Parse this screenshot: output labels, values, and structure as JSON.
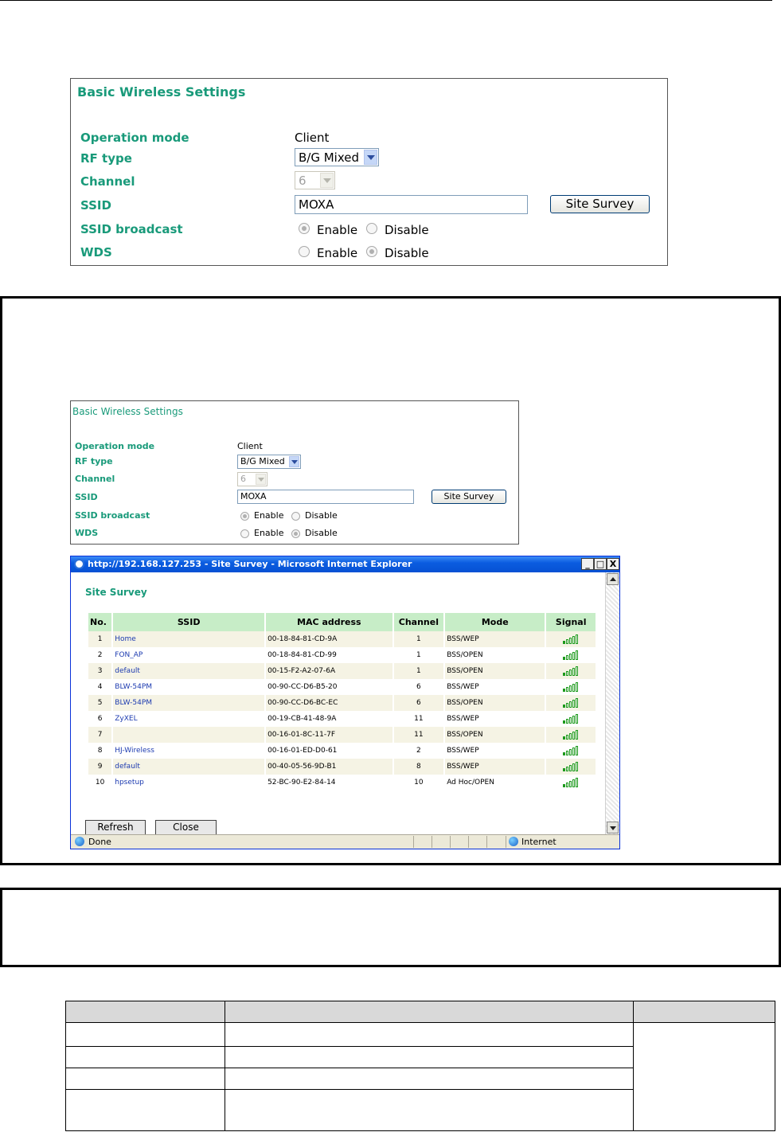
{
  "basic_settings": {
    "title": "Basic Wireless Settings",
    "fields": {
      "operation_mode": {
        "label": "Operation mode",
        "value": "Client"
      },
      "rf_type": {
        "label": "RF type",
        "value": "B/G Mixed"
      },
      "channel": {
        "label": "Channel",
        "value": "6"
      },
      "ssid": {
        "label": "SSID",
        "value": "MOXA"
      },
      "ssid_broadcast": {
        "label": "SSID broadcast",
        "enable": "Enable",
        "disable": "Disable",
        "selected": "Enable"
      },
      "wds": {
        "label": "WDS",
        "enable": "Enable",
        "disable": "Disable",
        "selected": "Disable"
      }
    },
    "site_survey_button": "Site Survey"
  },
  "ie_window": {
    "title": "http://192.168.127.253 - Site Survey - Microsoft Internet Explorer",
    "page_title": "Site Survey",
    "columns": [
      "No.",
      "SSID",
      "MAC address",
      "Channel",
      "Mode",
      "Signal"
    ],
    "rows": [
      {
        "no": "1",
        "ssid": "Home",
        "mac": "00-18-84-81-CD-9A",
        "channel": "1",
        "mode": "BSS/WEP",
        "signal": 5
      },
      {
        "no": "2",
        "ssid": "FON_AP",
        "mac": "00-18-84-81-CD-99",
        "channel": "1",
        "mode": "BSS/OPEN",
        "signal": 5
      },
      {
        "no": "3",
        "ssid": "default",
        "mac": "00-15-F2-A2-07-6A",
        "channel": "1",
        "mode": "BSS/OPEN",
        "signal": 5
      },
      {
        "no": "4",
        "ssid": "BLW-54PM",
        "mac": "00-90-CC-D6-B5-20",
        "channel": "6",
        "mode": "BSS/WEP",
        "signal": 5
      },
      {
        "no": "5",
        "ssid": "BLW-54PM",
        "mac": "00-90-CC-D6-BC-EC",
        "channel": "6",
        "mode": "BSS/OPEN",
        "signal": 5
      },
      {
        "no": "6",
        "ssid": "ZyXEL",
        "mac": "00-19-CB-41-48-9A",
        "channel": "11",
        "mode": "BSS/WEP",
        "signal": 5
      },
      {
        "no": "7",
        "ssid": "",
        "mac": "00-16-01-8C-11-7F",
        "channel": "11",
        "mode": "BSS/OPEN",
        "signal": 5
      },
      {
        "no": "8",
        "ssid": "HJ-Wireless",
        "mac": "00-16-01-ED-D0-61",
        "channel": "2",
        "mode": "BSS/WEP",
        "signal": 5
      },
      {
        "no": "9",
        "ssid": "default",
        "mac": "00-40-05-56-9D-B1",
        "channel": "8",
        "mode": "BSS/WEP",
        "signal": 5
      },
      {
        "no": "10",
        "ssid": "hpsetup",
        "mac": "52-BC-90-E2-84-14",
        "channel": "10",
        "mode": "Ad Hoc/OPEN",
        "signal": 5
      }
    ],
    "refresh_button": "Refresh",
    "close_button": "Close",
    "status_text": "Done",
    "zone_text": "Internet",
    "minimize_glyph": "_",
    "maximize_glyph": "□",
    "close_glyph": "X"
  },
  "colors": {
    "accent_green": "#199a7a",
    "link_blue": "#1d3bb0",
    "header_green": "#c7edc7"
  }
}
